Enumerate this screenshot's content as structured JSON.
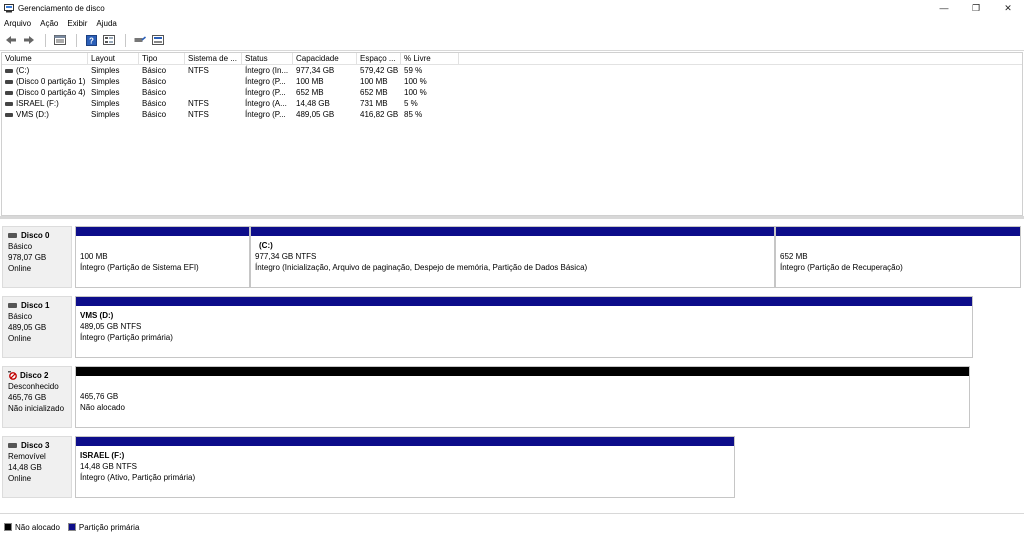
{
  "window": {
    "title": "Gerenciamento de disco",
    "minimize_glyph": "—",
    "maximize_glyph": "❐",
    "close_glyph": "✕"
  },
  "menu": [
    "Arquivo",
    "Ação",
    "Exibir",
    "Ajuda"
  ],
  "toolbar_icons": [
    "back-arrow-icon",
    "forward-arrow-icon",
    "disk-list-icon",
    "help-icon",
    "properties-icon",
    "connect-icon",
    "volume-list-icon"
  ],
  "volume_table": {
    "headers": [
      "Volume",
      "Layout",
      "Tipo",
      "Sistema de ...",
      "Status",
      "Capacidade",
      "Espaço ...",
      "% Livre"
    ],
    "rows": [
      [
        "(C:)",
        "Simples",
        "Básico",
        "NTFS",
        "Íntegro (In...",
        "977,34 GB",
        "579,42 GB",
        "59 %"
      ],
      [
        "(Disco 0 partição 1)",
        "Simples",
        "Básico",
        "",
        "Íntegro (P...",
        "100 MB",
        "100 MB",
        "100 %"
      ],
      [
        "(Disco 0 partição 4)",
        "Simples",
        "Básico",
        "",
        "Íntegro (P...",
        "652 MB",
        "652 MB",
        "100 %"
      ],
      [
        "ISRAEL (F:)",
        "Simples",
        "Básico",
        "NTFS",
        "Íntegro (A...",
        "14,48 GB",
        "731 MB",
        "5 %"
      ],
      [
        "VMS (D:)",
        "Simples",
        "Básico",
        "NTFS",
        "Íntegro (P...",
        "489,05 GB",
        "416,82 GB",
        "85 %"
      ]
    ]
  },
  "disks": [
    {
      "name": "Disco 0",
      "type": "Básico",
      "size": "978,07 GB",
      "state": "Online",
      "partitions": [
        {
          "name": "",
          "size": "100 MB",
          "status": "Íntegro (Partição de Sistema EFI)",
          "bar": "primary"
        },
        {
          "name": "(C:)",
          "size": "977,34 GB NTFS",
          "status": "Íntegro (Inicialização, Arquivo de paginação, Despejo de memória, Partição de Dados Básica)",
          "bar": "primary"
        },
        {
          "name": "",
          "size": "652 MB",
          "status": "Íntegro (Partição de Recuperação)",
          "bar": "primary"
        }
      ]
    },
    {
      "name": "Disco 1",
      "type": "Básico",
      "size": "489,05 GB",
      "state": "Online",
      "partitions": [
        {
          "name": "VMS  (D:)",
          "size": "489,05 GB NTFS",
          "status": "Íntegro (Partição primária)",
          "bar": "primary"
        }
      ]
    },
    {
      "name": "Disco 2",
      "type": "Desconhecido",
      "size": "465,76 GB",
      "state": "Não inicializado",
      "partitions": [
        {
          "name": "",
          "size": "465,76 GB",
          "status": "Não alocado",
          "bar": "unalloc"
        }
      ]
    },
    {
      "name": "Disco 3",
      "type": "Removível",
      "size": "14,48 GB",
      "state": "Online",
      "partitions": [
        {
          "name": "ISRAEL  (F:)",
          "size": "14,48 GB NTFS",
          "status": "Íntegro (Ativo, Partição primária)",
          "bar": "primary"
        }
      ]
    }
  ],
  "legend": [
    {
      "label": "Não alocado",
      "color": "#000000"
    },
    {
      "label": "Partição primária",
      "color": "#0d0d8a"
    }
  ]
}
